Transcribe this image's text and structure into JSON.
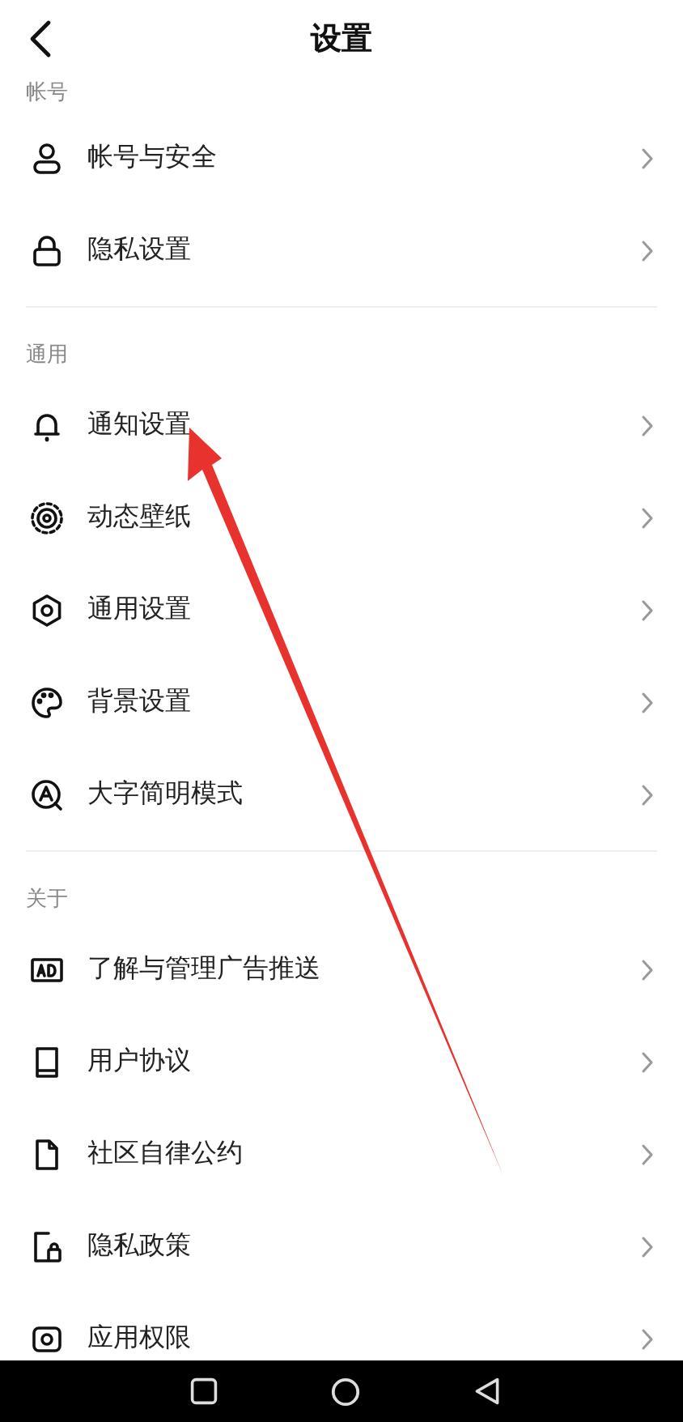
{
  "header": {
    "title": "设置"
  },
  "sections": [
    {
      "label": "帐号",
      "items": [
        {
          "label": "帐号与安全"
        },
        {
          "label": "隐私设置"
        }
      ]
    },
    {
      "label": "通用",
      "items": [
        {
          "label": "通知设置"
        },
        {
          "label": "动态壁纸"
        },
        {
          "label": "通用设置"
        },
        {
          "label": "背景设置"
        },
        {
          "label": "大字简明模式"
        }
      ]
    },
    {
      "label": "关于",
      "items": [
        {
          "label": "了解与管理广告推送"
        },
        {
          "label": "用户协议"
        },
        {
          "label": "社区自律公约"
        },
        {
          "label": "隐私政策"
        },
        {
          "label": "应用权限"
        }
      ]
    }
  ]
}
